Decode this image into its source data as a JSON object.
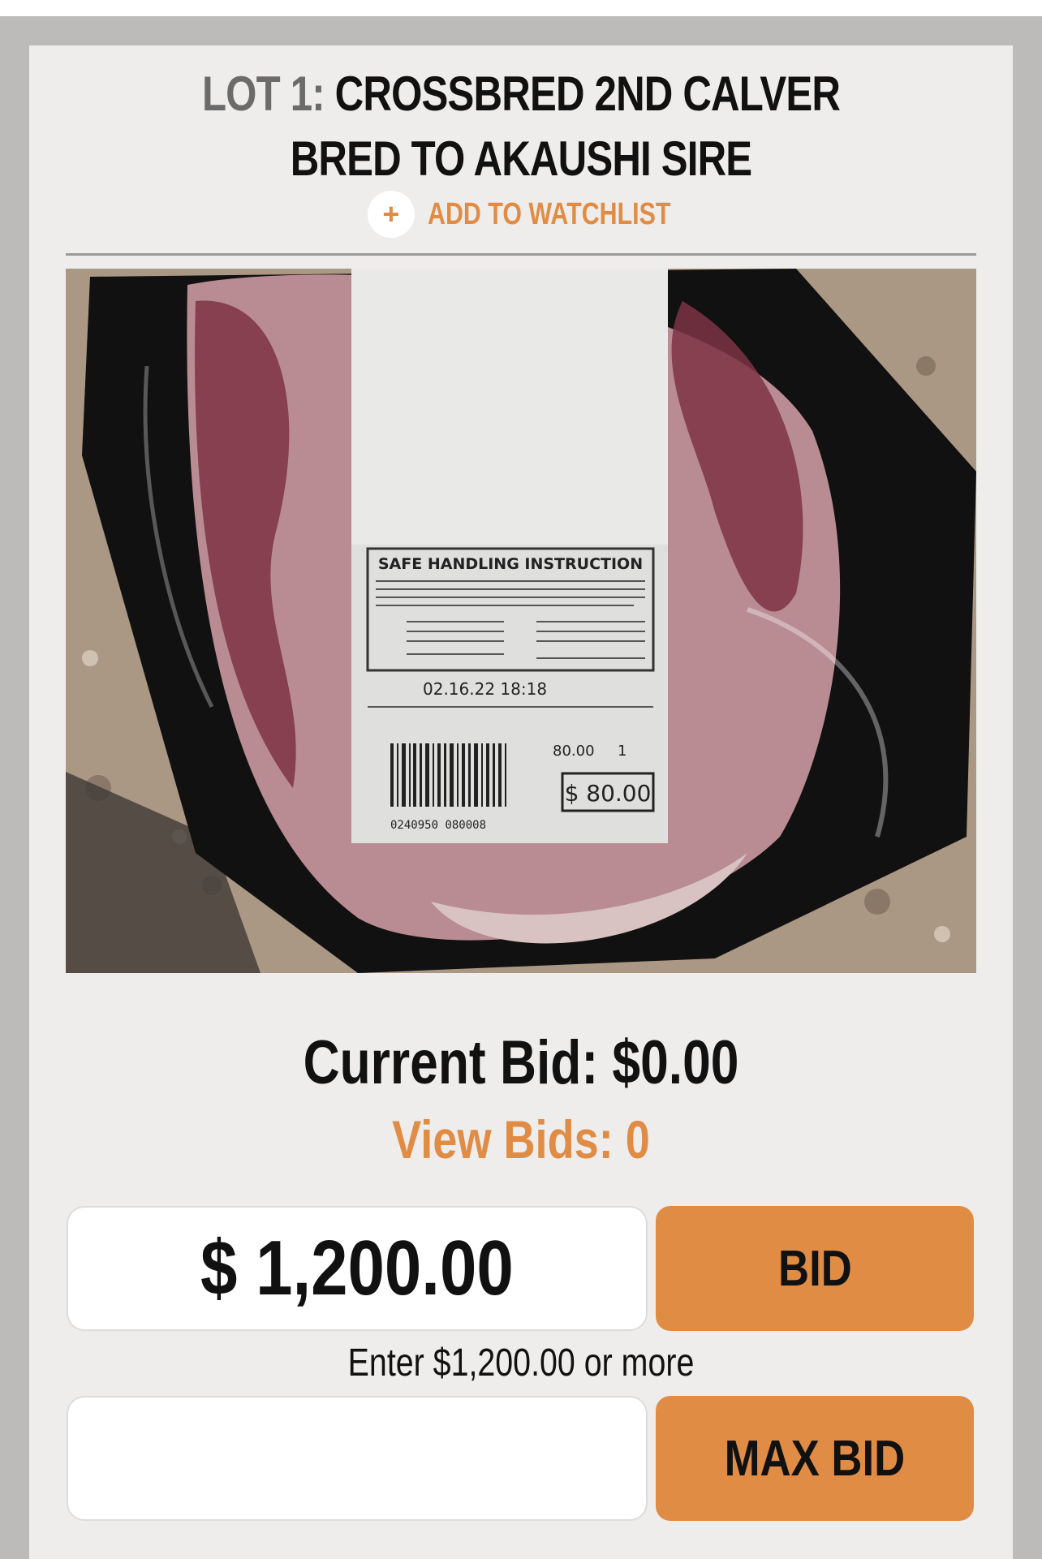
{
  "lot": {
    "prefix": "LOT 1:",
    "title": "CROSSBRED 2ND CALVER BRED TO AKAUSHI SIRE",
    "watchlist_icon": "+",
    "watchlist_label": "ADD TO WATCHLIST"
  },
  "photo": {
    "alt": "Vacuum-packed steak with price label",
    "label_heading": "SAFE HANDLING INSTRUCTION",
    "packed_on": "02.16.22 18:18",
    "price_per_pc": "80.00",
    "quantity": "1",
    "price": "$ 80.00",
    "barcode_number": "0240950 080008"
  },
  "bidding": {
    "current_bid": "Current Bid: $0.00",
    "view_bids": "View Bids: 0",
    "bid_amount": "$ 1,200.00",
    "bid_button": "BID",
    "hint": "Enter $1,200.00 or more",
    "max_bid_value": "",
    "max_bid_button": "MAX BID"
  },
  "colors": {
    "accent": "#e08c45",
    "card": "#eeedeb",
    "page": "#bcbbb9"
  }
}
